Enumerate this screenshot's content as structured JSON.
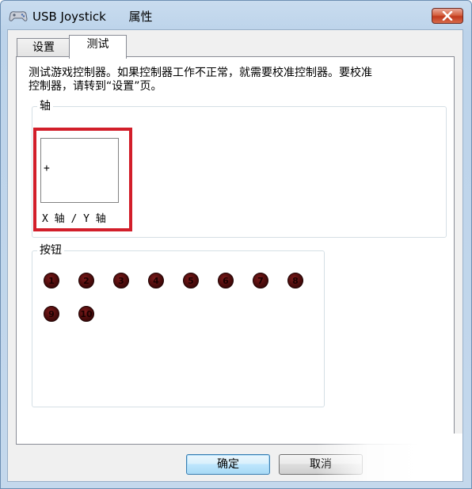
{
  "window": {
    "title_device": "USB Joystick",
    "title_suffix": "属性"
  },
  "tabs": [
    {
      "label": "设置",
      "active": false
    },
    {
      "label": "测试",
      "active": true
    }
  ],
  "description": {
    "line1": "测试游戏控制器。如果控制器工作不正常，就需要校准控制器。要校准",
    "line2": "控制器，请转到“设置”页。"
  },
  "axis_group": {
    "label": "轴",
    "crosshair": "+",
    "xy_label": "X 轴 / Y 轴"
  },
  "buttons_group": {
    "label": "按钮",
    "buttons": [
      "1",
      "2",
      "3",
      "4",
      "5",
      "6",
      "7",
      "8",
      "9",
      "10"
    ],
    "button_color": "#4a0b0b"
  },
  "footer": {
    "ok_label": "确定",
    "cancel_label": "取消"
  },
  "colors": {
    "highlight": "#d21e2a",
    "close_button": "#c0391c"
  },
  "icons": {
    "title": "game-controller-icon",
    "close": "close-icon"
  }
}
